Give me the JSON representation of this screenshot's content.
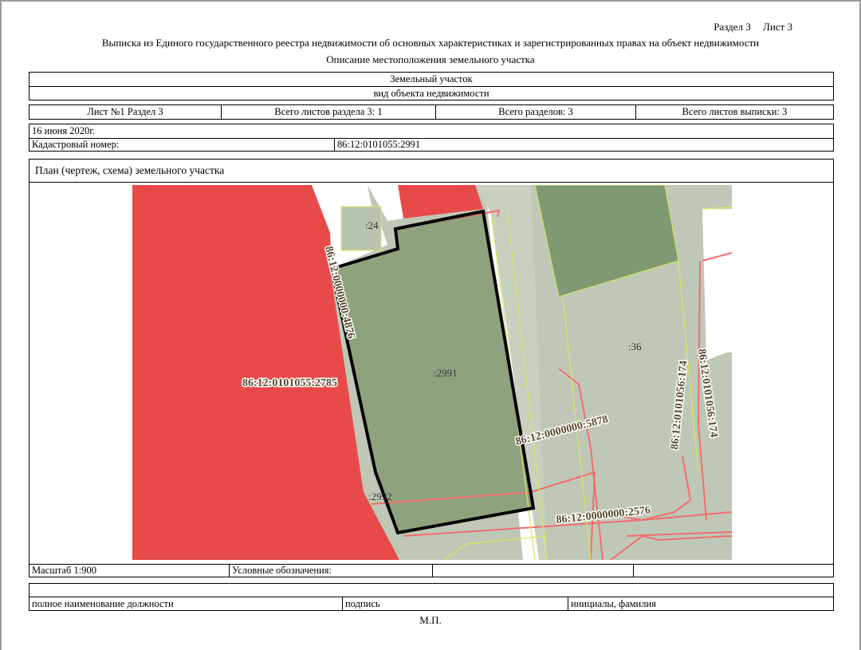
{
  "header": {
    "section": "Раздел 3",
    "sheet": "Лист 3",
    "title": "Выписка из Единого государственного реестра недвижимости об основных характеристиках и зарегистрированных правах на объект недвижимости",
    "subtitle": "Описание местоположения земельного участка"
  },
  "object": {
    "type": "Земельный участок",
    "kind_label": "вид объекта недвижимости"
  },
  "sheet_info": {
    "sheet_section": "Лист №1  Раздел 3",
    "total_section_sheets": "Всего листов раздела 3: 1",
    "total_sections": "Всего разделов: 3",
    "total_extract_sheets": "Всего листов выписки: 3"
  },
  "date": "16 июня 2020г.",
  "cadastral": {
    "label": "Кадастровый номер:",
    "value": "86:12:0101055:2991"
  },
  "plan_title": "План (чертеж, схема) земельного участка",
  "map": {
    "labels": {
      "parcel_24": ":24",
      "parcel_2991": ":2991",
      "parcel_2992": ":2992",
      "parcel_36": ":36",
      "parcel_2785": "86:12:0101055:2785",
      "parcel_4876": "86:12:0000000:4876",
      "parcel_5878": "86:12:0000000:5878",
      "parcel_2576": "86:12:0000000:2576",
      "parcel_174a": "86:12:0101056:174",
      "parcel_174b": "86:12:0101056:174"
    },
    "colors": {
      "red_parcel": "#e84a4a",
      "subject_parcel": "#8fa27e",
      "dark_parcel": "#7f9a72",
      "light_parcel": "#bfc8b6",
      "road": "#ffffff",
      "boundary_line": "#f26d6d",
      "yellow_line": "#d9e85c"
    }
  },
  "scale": "Масштаб 1:900",
  "legend_label": "Условные обозначения:",
  "signature": {
    "position": "полное наименование должности",
    "sign": "подпись",
    "name": "инициалы, фамилия"
  },
  "stamp": "М.П."
}
